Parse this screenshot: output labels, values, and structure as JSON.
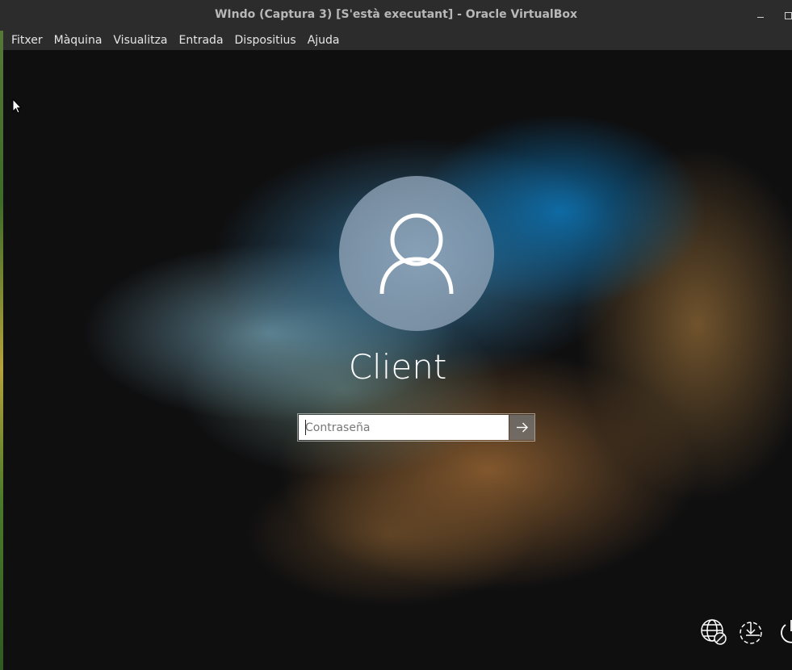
{
  "window": {
    "title": "WIndo (Captura 3) [S'està executant] - Oracle VirtualBox",
    "minimize_icon": "minimize-icon",
    "maximize_icon": "maximize-icon"
  },
  "menubar": {
    "items": [
      {
        "label": "Fitxer"
      },
      {
        "label": "Màquina"
      },
      {
        "label": "Visualitza"
      },
      {
        "label": "Entrada"
      },
      {
        "label": "Dispositius"
      },
      {
        "label": "Ajuda"
      }
    ]
  },
  "login": {
    "username": "Client",
    "password_placeholder": "Contraseña",
    "password_value": "",
    "avatar_icon": "user-icon",
    "submit_icon": "arrow-right-icon"
  },
  "bottom_icons": [
    {
      "name": "network-icon"
    },
    {
      "name": "ease-of-access-icon"
    },
    {
      "name": "power-icon"
    }
  ],
  "colors": {
    "titlebar_bg": "#2c2c2c",
    "screen_bg": "#0f0f10",
    "accent_blue": "#0e6eaa",
    "text_white": "#ffffff"
  }
}
